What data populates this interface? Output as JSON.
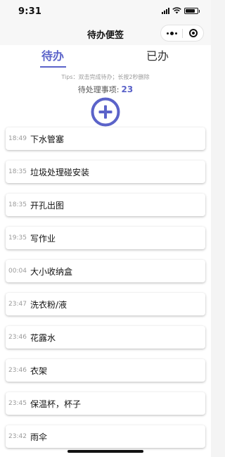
{
  "status_bar": {
    "time": "9:31",
    "battery_level": 0.8
  },
  "nav": {
    "title": "待办便签",
    "more_icon": "more-dots-icon",
    "close_icon": "close-target-icon"
  },
  "tabs": [
    {
      "label": "待办",
      "active": true
    },
    {
      "label": "已办",
      "active": false
    }
  ],
  "tips": "Tips：双击完成待办；长按2秒删除",
  "pending": {
    "label": "待处理事项:",
    "count": "23"
  },
  "add_button": {
    "icon": "plus-circle-icon",
    "color": "#5b63c9"
  },
  "accent_color": "#5b63c9",
  "todos": [
    {
      "time": "18:49",
      "text": "下水管塞"
    },
    {
      "time": "18:35",
      "text": "垃圾处理碰安装"
    },
    {
      "time": "18:35",
      "text": "开孔出图"
    },
    {
      "time": "19:35",
      "text": "写作业"
    },
    {
      "time": "00:04",
      "text": "大小收纳盒"
    },
    {
      "time": "23:47",
      "text": "洗衣粉/液"
    },
    {
      "time": "23:46",
      "text": "花露水"
    },
    {
      "time": "23:46",
      "text": "衣架"
    },
    {
      "time": "23:45",
      "text": "保温杯，杯子"
    },
    {
      "time": "23:42",
      "text": "雨伞"
    }
  ]
}
